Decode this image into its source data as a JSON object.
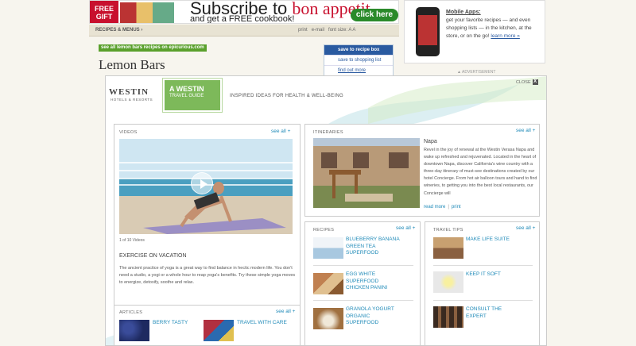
{
  "ad_banner": {
    "free_gift": "FREE GIFT",
    "subscribe_text": "Subscribe to",
    "brand": "bon appetit",
    "free_cookbook": "and get a FREE cookbook!",
    "click_here": "click here"
  },
  "nav": {
    "recipes_menu": "RECIPES & MENUS ›",
    "print": "print",
    "email": "e-mail",
    "font_size": "font size: A A"
  },
  "page": {
    "see_all_link": "see all lemon bars recipes on epicurious.com",
    "title": "Lemon Bars",
    "save_recipe_box": "save to recipe box",
    "save_shopping_list": "save to shopping list",
    "find_out_more": "find out more"
  },
  "side_ad": {
    "title": "Mobile Apps:",
    "text": "get your favorite recipes — and even shopping lists — in the kitchen, at the store, or on the go!",
    "learn_more": "learn more »",
    "advertisement": "▲ ADVERTISEMENT"
  },
  "overlay": {
    "brand": "WESTIN",
    "brand_sub": "HOTELS & RESORTS",
    "guide_line1": "A WESTIN",
    "guide_line2": "TRAVEL GUIDE",
    "tagline": "INSPIRED IDEAS FOR HEALTH & WELL-BEING",
    "close": "CLOSE",
    "close_x": "X",
    "videos": {
      "heading": "VIDEOS",
      "see_all": "see all +",
      "count": "1 of 10 Videos",
      "title": "EXERCISE ON VACATION",
      "description": "The ancient practice of yoga is a great way to find balance in hectic modern life. You don't need a studio, a yogi or a whole hour to reap yoga's benefits. Try these simple yoga moves to energize, detoxify, soothe and relax."
    },
    "itineraries": {
      "heading": "ITINERARIES",
      "see_all": "see all +",
      "name": "Napa",
      "description": "Revel in the joy of renewal at the Westin Verasa Napa and wake up refreshed and rejuvenated. Located in the heart of downtown Napa, discover California's wine country with a three-day itinerary of must-see destinations created by our hotel Concierge. From hot air balloon tours and hand to find wineries, to getting you into the best local restaurants, our Concierge will",
      "read_more": "read more",
      "print": "print"
    },
    "recipes": {
      "heading": "RECIPES",
      "see_all": "see all +",
      "items": [
        {
          "label_lines": [
            "BLUEBERRY BANANA",
            "GREEN TEA",
            "SUPERFOOD"
          ]
        },
        {
          "label_lines": [
            "EGG WHITE",
            "SUPERFOOD",
            "CHICKEN PANINI"
          ]
        },
        {
          "label_lines": [
            "GRANOLA YOGURT",
            "ORGANIC",
            "SUPERFOOD"
          ]
        }
      ]
    },
    "travel_tips": {
      "heading": "TRAVEL TIPS",
      "see_all": "see all +",
      "items": [
        {
          "label_lines": [
            "MAKE LIFE SUITE"
          ]
        },
        {
          "label_lines": [
            "KEEP IT SOFT"
          ]
        },
        {
          "label_lines": [
            "CONSULT THE",
            "EXPERT"
          ]
        }
      ]
    },
    "articles": {
      "heading": "ARTICLES",
      "see_all": "see all +",
      "items": [
        {
          "label": "BERRY TASTY"
        },
        {
          "label": "TRAVEL WITH CARE"
        }
      ]
    }
  },
  "colors": {
    "link": "#1f8ab8",
    "guide_green": "#7db95a",
    "page_bg": "#f7f5ee"
  }
}
